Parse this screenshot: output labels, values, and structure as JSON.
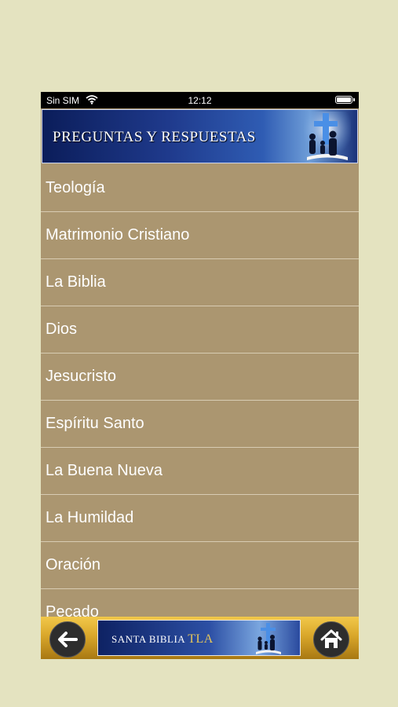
{
  "status_bar": {
    "carrier": "Sin SIM",
    "time": "12:12"
  },
  "header": {
    "title": "PREGUNTAS Y RESPUESTAS"
  },
  "menu": {
    "items": [
      {
        "label": "Teología"
      },
      {
        "label": "Matrimonio Cristiano"
      },
      {
        "label": "La Biblia"
      },
      {
        "label": "Dios"
      },
      {
        "label": "Jesucristo"
      },
      {
        "label": "Espíritu Santo"
      },
      {
        "label": "La Buena Nueva"
      },
      {
        "label": "La Humildad"
      },
      {
        "label": "Oración"
      },
      {
        "label": "Pecado"
      }
    ]
  },
  "bottom_bar": {
    "ad_label": "SANTA BIBLIA",
    "ad_label_accent": "TLA",
    "back_icon": "arrow-left-icon",
    "home_icon": "home-icon"
  },
  "colors": {
    "background": "#e4e3c0",
    "list_background": "#ab9670",
    "row_divider": "#d8ccb3",
    "banner_blue": "#1f3a8c",
    "bottom_bar_gold": "#d9a72a"
  }
}
